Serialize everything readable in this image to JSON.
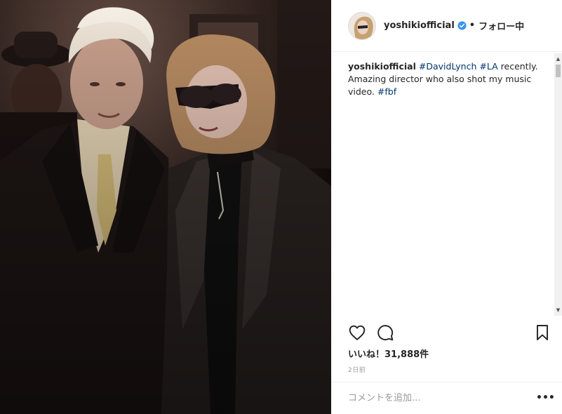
{
  "post": {
    "username": "yoshikiofficial",
    "follow_separator": "•",
    "follow_state": "フォロー中",
    "caption": {
      "username": "yoshikiofficial",
      "tag_1": "#DavidLynch",
      "tag_2": "#LA",
      "text_1": "recently.",
      "text_2": "Amazing director who also shot my music video.",
      "tag_3": "#fbf"
    },
    "likes_text": "いいね！31,888件",
    "timestamp": "2日前",
    "comment_placeholder": "コメントを追加...",
    "more_label": "•••"
  },
  "icons": {
    "avatar": "profile-avatar",
    "verified": "verified-badge-icon",
    "like": "heart-icon",
    "comment": "comment-bubble-icon",
    "save": "bookmark-icon"
  },
  "colors": {
    "verified": "#3897f0",
    "hashtag": "#003569",
    "text": "#262626",
    "muted": "#999999"
  }
}
